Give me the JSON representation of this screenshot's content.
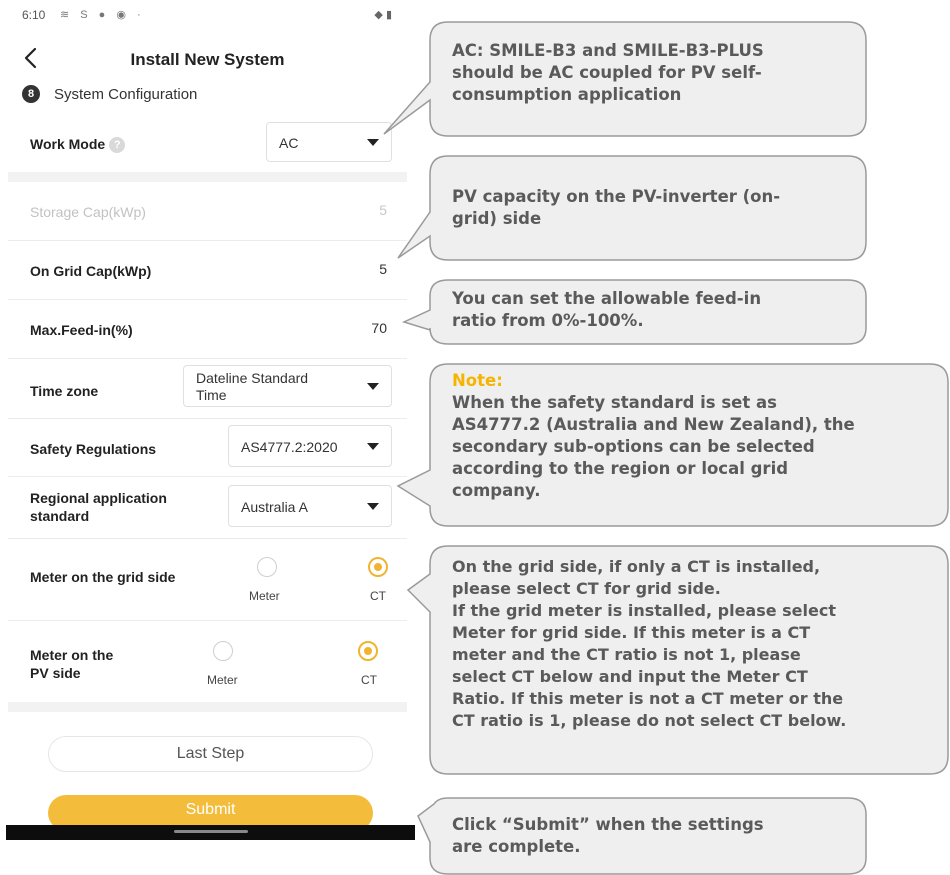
{
  "status_bar": {
    "time": "6:10",
    "left_icons": "≋ S ● ◉ ·",
    "right_icons": "◆ ▮"
  },
  "header": {
    "title": "Install New System"
  },
  "step": {
    "number": "8",
    "label": "System Configuration"
  },
  "fields": {
    "work_mode": {
      "label": "Work Mode",
      "value": "AC",
      "help_icon": "?"
    },
    "storage_cap": {
      "label": "Storage Cap(kWp)",
      "value": "5"
    },
    "on_grid_cap": {
      "label": "On Grid Cap(kWp)",
      "value": "5"
    },
    "max_feed_in": {
      "label": "Max.Feed-in(%)",
      "value": "70"
    },
    "time_zone": {
      "label": "Time zone",
      "value_line1": "Dateline Standard",
      "value_line2": "Time"
    },
    "safety_regulations": {
      "label": "Safety Regulations",
      "value": "AS4777.2:2020"
    },
    "regional_standard": {
      "label_line1": "Regional application",
      "label_line2": "standard",
      "value": "Australia A"
    },
    "meter_grid": {
      "label": "Meter on the grid side",
      "option_meter": "Meter",
      "option_ct": "CT",
      "selected": "CT"
    },
    "meter_pv": {
      "label_line1": "Meter on the",
      "label_line2": "PV side",
      "option_meter": "Meter",
      "option_ct": "CT",
      "selected": "CT"
    }
  },
  "buttons": {
    "last_step": "Last Step",
    "submit": "Submit"
  },
  "colors": {
    "accent": "#f1b431",
    "callout_fill": "#efefef",
    "callout_text": "#5a5a5a",
    "note": "#f5b400"
  },
  "callouts": {
    "work_mode": {
      "line1": "AC: SMILE-B3 and SMILE-B3-PLUS",
      "line2": "should be AC coupled for PV self-",
      "line3": "consumption application"
    },
    "on_grid_cap": {
      "line1": "PV capacity on the PV-inverter (on-",
      "line2": "grid) side"
    },
    "feed_in": {
      "line1": "You can set the allowable feed-in",
      "line2": "ratio from 0%-100%."
    },
    "regional": {
      "note_label": "Note:",
      "line1": "When the safety standard is set as",
      "line2": "AS4777.2 (Australia and New Zealand), the",
      "line3": "secondary sub-options can be selected",
      "line4": "according to the region or local grid",
      "line5": "company."
    },
    "meters": {
      "line1": "On the grid side, if only a CT is installed,",
      "line2": "please select CT for grid side.",
      "line3": "If the grid meter is installed, please select",
      "line4": "Meter for grid side. If this meter is a CT",
      "line5": "meter and the CT ratio is not 1, please",
      "line6": "select CT below and input the Meter CT",
      "line7": "Ratio. If this meter is not a CT meter or the",
      "line8": "CT ratio is 1, please do not select CT below."
    },
    "submit": {
      "line1": "Click “Submit” when the settings",
      "line2": "are complete."
    }
  }
}
